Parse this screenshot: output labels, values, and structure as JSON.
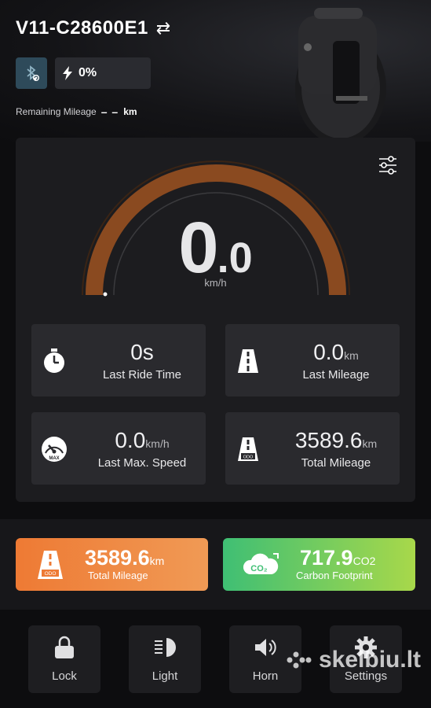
{
  "header": {
    "device_name": "V11-C28600E1",
    "swap_icon": "⇄",
    "bluetooth_icon": "bluetooth-icon",
    "battery_percent": "0%",
    "remaining_label": "Remaining Mileage",
    "remaining_value": "– –",
    "remaining_unit": "km"
  },
  "dashboard": {
    "speed_integer": "0",
    "speed_decimal": ".0",
    "speed_unit": "km/h",
    "gauge_level": 0,
    "accent_color": "#8a4a20",
    "stats": [
      {
        "value": "0s",
        "unit": "",
        "label": "Last Ride Time",
        "icon": "stopwatch-icon"
      },
      {
        "value": "0.0",
        "unit": "km",
        "label": "Last Mileage",
        "icon": "road-icon"
      },
      {
        "value": "0.0",
        "unit": "km/h",
        "label": "Last Max. Speed",
        "icon": "speedometer-icon"
      },
      {
        "value": "3589.6",
        "unit": "km",
        "label": "Total Mileage",
        "icon": "odometer-road-icon"
      }
    ]
  },
  "summary": {
    "total_mileage_value": "3589.6",
    "total_mileage_unit": "km",
    "total_mileage_label": "Total Mileage",
    "carbon_value": "717.9",
    "carbon_unit": "CO2",
    "carbon_label": "Carbon Footprint",
    "orange": "#ee7a34",
    "green": "#3fbf74"
  },
  "toolbar": {
    "lock_label": "Lock",
    "light_label": "Light",
    "horn_label": "Horn",
    "settings_label": "Settings"
  },
  "watermark": {
    "text": "skelbiu.lt"
  }
}
